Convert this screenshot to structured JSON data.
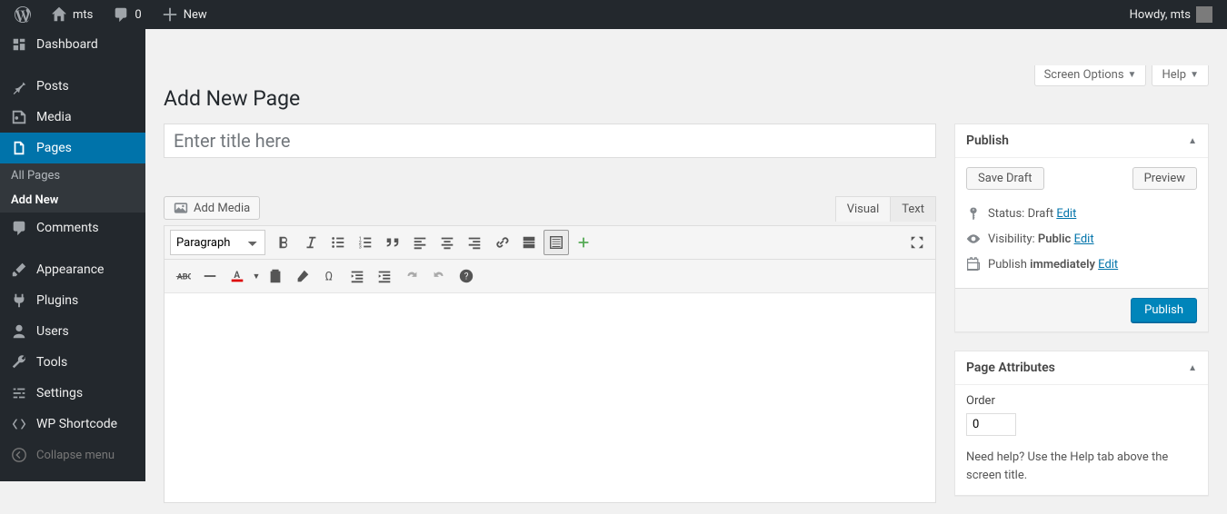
{
  "adminbar": {
    "site_name": "mts",
    "comments_count": "0",
    "new_label": "New",
    "howdy": "Howdy, mts"
  },
  "menu": {
    "dashboard": "Dashboard",
    "posts": "Posts",
    "media": "Media",
    "pages": "Pages",
    "pages_sub_all": "All Pages",
    "pages_sub_add": "Add New",
    "comments": "Comments",
    "appearance": "Appearance",
    "plugins": "Plugins",
    "users": "Users",
    "tools": "Tools",
    "settings": "Settings",
    "wp_shortcode": "WP Shortcode",
    "collapse": "Collapse menu"
  },
  "screen_meta": {
    "screen_options": "Screen Options",
    "help": "Help"
  },
  "page": {
    "heading": "Add New Page",
    "title_placeholder": "Enter title here",
    "add_media": "Add Media",
    "tab_visual": "Visual",
    "tab_text": "Text",
    "format_select": "Paragraph"
  },
  "publish": {
    "title": "Publish",
    "save_draft": "Save Draft",
    "preview": "Preview",
    "status_label": "Status:",
    "status_value": "Draft",
    "visibility_label": "Visibility:",
    "visibility_value": "Public",
    "schedule_label": "Publish",
    "schedule_value": "immediately",
    "edit": "Edit",
    "publish_btn": "Publish"
  },
  "page_attributes": {
    "title": "Page Attributes",
    "order_label": "Order",
    "order_value": "0",
    "help_text": "Need help? Use the Help tab above the screen title."
  }
}
